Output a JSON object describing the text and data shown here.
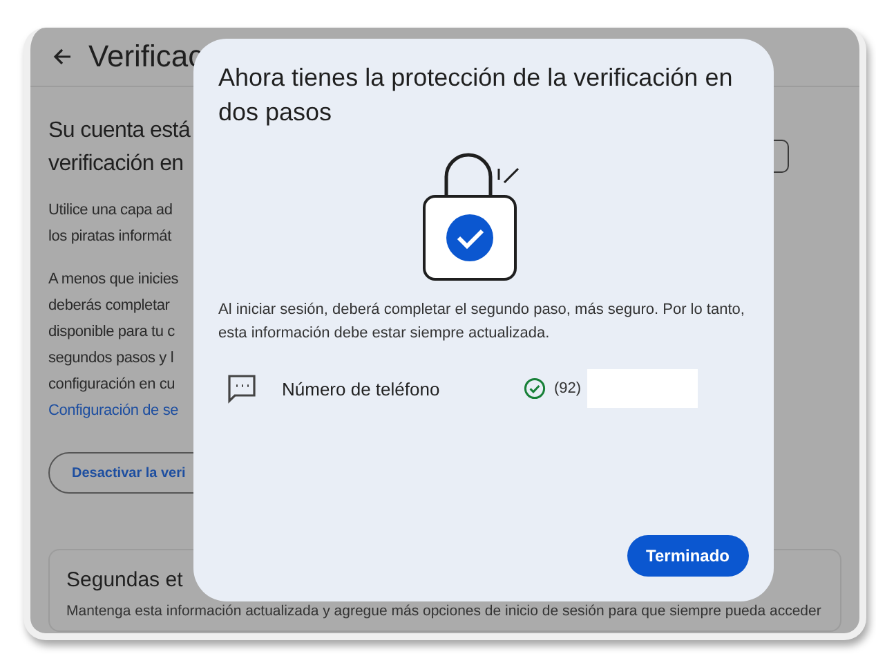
{
  "background_page": {
    "title": "Verificac",
    "heading_lines": [
      "Su cuenta está",
      "verificación en"
    ],
    "paragraphs": [
      [
        "Utilice una capa ad",
        "los piratas informát"
      ],
      [
        "A menos que inicies",
        "deberás completar",
        "disponible para tu c",
        "segundos pasos y l",
        "configuración en cu"
      ]
    ],
    "link": "Configuración de se",
    "button": "Desactivar la veri",
    "card": {
      "title": "Segundas et",
      "text": "Mantenga esta información actualizada y agregue más opciones de inicio de sesión para que siempre pueda acceder"
    }
  },
  "dialog": {
    "title": "Ahora tienes la protección de la verificación en dos pasos",
    "body": "Al iniciar sesión, deberá completar el segundo paso, más seguro. Por lo tanto, esta información debe estar siempre actualizada.",
    "methods": [
      {
        "label": "Número de teléfono",
        "verified": true,
        "value": "(92)"
      }
    ],
    "button": "Terminado"
  }
}
